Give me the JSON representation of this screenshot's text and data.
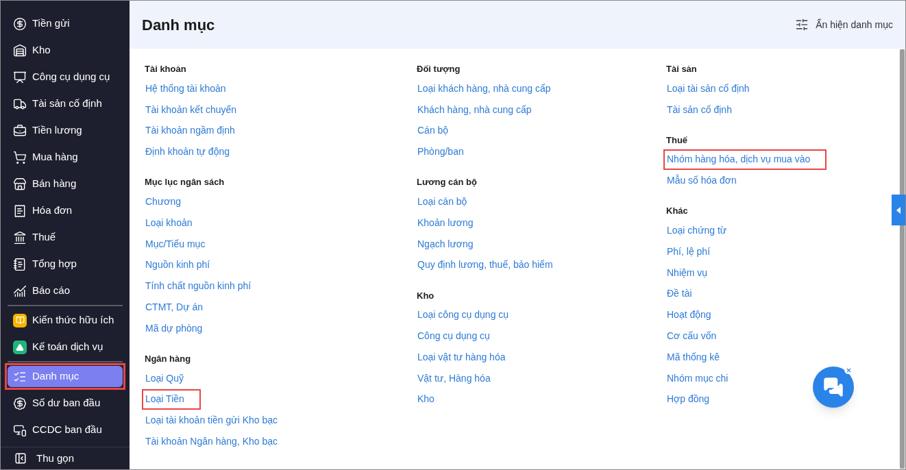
{
  "sidebar": {
    "items": [
      {
        "label": "Tiền gửi",
        "selected": false,
        "highlighted": false,
        "divider_after": false
      },
      {
        "label": "Kho",
        "selected": false,
        "highlighted": false,
        "divider_after": false
      },
      {
        "label": "Công cụ dụng cụ",
        "selected": false,
        "highlighted": false,
        "divider_after": false
      },
      {
        "label": "Tài sản cố định",
        "selected": false,
        "highlighted": false,
        "divider_after": false
      },
      {
        "label": "Tiền lương",
        "selected": false,
        "highlighted": false,
        "divider_after": false
      },
      {
        "label": "Mua hàng",
        "selected": false,
        "highlighted": false,
        "divider_after": false
      },
      {
        "label": "Bán hàng",
        "selected": false,
        "highlighted": false,
        "divider_after": false
      },
      {
        "label": "Hóa đơn",
        "selected": false,
        "highlighted": false,
        "divider_after": false
      },
      {
        "label": "Thuế",
        "selected": false,
        "highlighted": false,
        "divider_after": false
      },
      {
        "label": "Tổng hợp",
        "selected": false,
        "highlighted": false,
        "divider_after": false
      },
      {
        "label": "Báo cáo",
        "selected": false,
        "highlighted": false,
        "divider_after": true
      },
      {
        "label": "Kiến thức hữu ích",
        "selected": false,
        "highlighted": false,
        "divider_after": false
      },
      {
        "label": "Kế toán dịch vụ",
        "selected": false,
        "highlighted": false,
        "divider_after": true
      },
      {
        "label": "Danh mục",
        "selected": true,
        "highlighted": true,
        "divider_after": false
      },
      {
        "label": "Số dư ban đầu",
        "selected": false,
        "highlighted": false,
        "divider_after": false
      },
      {
        "label": "CCDC ban đầu",
        "selected": false,
        "highlighted": false,
        "divider_after": false
      }
    ],
    "collapse": "Thu gọn"
  },
  "header": {
    "title": "Danh mục",
    "toggle": "Ẩn hiện danh mục"
  },
  "columns": [
    [
      {
        "title": "Tài khoản",
        "items": [
          {
            "label": "Hệ thống tài khoản",
            "highlighted": false
          },
          {
            "label": "Tài khoản kết chuyển",
            "highlighted": false
          },
          {
            "label": "Tài khoản ngầm định",
            "highlighted": false
          },
          {
            "label": "Định khoản tự động",
            "highlighted": false
          }
        ]
      },
      {
        "title": "Mục lục ngân sách",
        "items": [
          {
            "label": "Chương",
            "highlighted": false
          },
          {
            "label": "Loại khoản",
            "highlighted": false
          },
          {
            "label": "Mục/Tiểu mục",
            "highlighted": false
          },
          {
            "label": "Nguồn kinh phí",
            "highlighted": false
          },
          {
            "label": "Tính chất nguồn kinh phí",
            "highlighted": false
          },
          {
            "label": "CTMT, Dự án",
            "highlighted": false
          },
          {
            "label": "Mã dự phòng",
            "highlighted": false
          }
        ]
      },
      {
        "title": "Ngân hàng",
        "items": [
          {
            "label": "Loại Quỹ",
            "highlighted": false
          },
          {
            "label": "Loại Tiền",
            "highlighted": true
          },
          {
            "label": "Loại tài khoản tiền gửi Kho bạc",
            "highlighted": false
          },
          {
            "label": "Tài khoản Ngân hàng, Kho bạc",
            "highlighted": false
          }
        ]
      }
    ],
    [
      {
        "title": "Đối tượng",
        "items": [
          {
            "label": "Loại khách hàng, nhà cung cấp",
            "highlighted": false
          },
          {
            "label": "Khách hàng, nhà cung cấp",
            "highlighted": false
          },
          {
            "label": "Cán bộ",
            "highlighted": false
          },
          {
            "label": "Phòng/ban",
            "highlighted": false
          }
        ]
      },
      {
        "title": "Lương cán bộ",
        "items": [
          {
            "label": "Loại cán bộ",
            "highlighted": false
          },
          {
            "label": "Khoản lương",
            "highlighted": false
          },
          {
            "label": "Ngạch lương",
            "highlighted": false
          },
          {
            "label": "Quy định lương, thuế, bảo hiểm",
            "highlighted": false
          }
        ]
      },
      {
        "title": "Kho",
        "items": [
          {
            "label": "Loại công cụ dụng cụ",
            "highlighted": false
          },
          {
            "label": "Công cụ dụng cụ",
            "highlighted": false
          },
          {
            "label": "Loại vật tư hàng hóa",
            "highlighted": false
          },
          {
            "label": "Vật tư, Hàng hóa",
            "highlighted": false
          },
          {
            "label": "Kho",
            "highlighted": false
          }
        ]
      }
    ],
    [
      {
        "title": "Tài sản",
        "items": [
          {
            "label": "Loại tài sản cố định",
            "highlighted": false
          },
          {
            "label": "Tài sản cố định",
            "highlighted": false
          }
        ]
      },
      {
        "title": "Thuế",
        "items": [
          {
            "label": "Nhóm hàng hóa, dịch vụ mua vào",
            "highlighted": true
          },
          {
            "label": "Mẫu số hóa đơn",
            "highlighted": false
          }
        ]
      },
      {
        "title": "Khác",
        "items": [
          {
            "label": "Loại chứng từ",
            "highlighted": false
          },
          {
            "label": "Phí, lệ phí",
            "highlighted": false
          },
          {
            "label": "Nhiệm vụ",
            "highlighted": false
          },
          {
            "label": "Đề tài",
            "highlighted": false
          },
          {
            "label": "Hoạt động",
            "highlighted": false
          },
          {
            "label": "Cơ cấu vốn",
            "highlighted": false
          },
          {
            "label": "Mã thống kê",
            "highlighted": false
          },
          {
            "label": "Nhóm mục chi",
            "highlighted": false
          },
          {
            "label": "Hợp đồng",
            "highlighted": false
          }
        ]
      }
    ]
  ]
}
